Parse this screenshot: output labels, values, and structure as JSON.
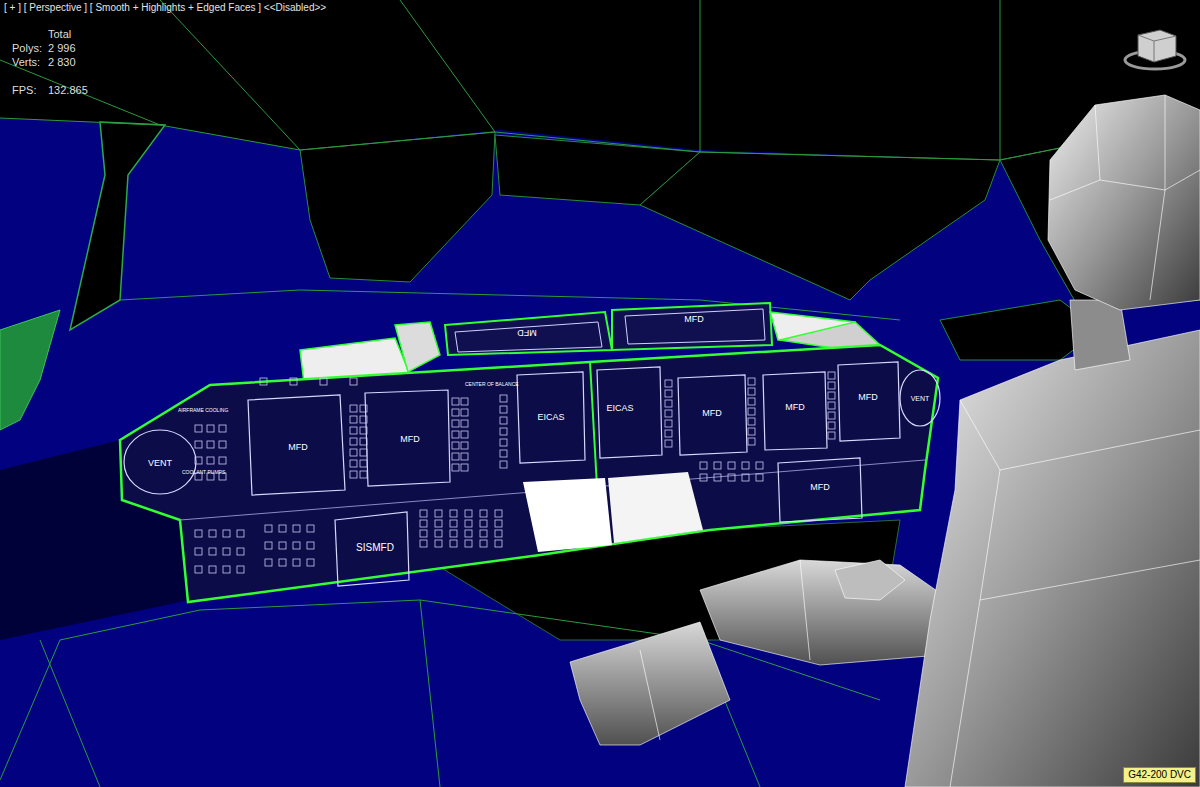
{
  "viewport": {
    "label": "[ + ] [ Perspective ] [ Smooth + Highlights + Edged Faces ] <<Disabled>>"
  },
  "stats": {
    "heading": "Total",
    "rows": [
      {
        "label": "Polys:",
        "value": "2 996"
      },
      {
        "label": "Verts:",
        "value": "2 830"
      }
    ],
    "fps_label": "FPS:",
    "fps_value": "132.865"
  },
  "scene": {
    "panel_labels": [
      "MFD",
      "MFD",
      "VENT",
      "MFD",
      "MFD",
      "EICAS",
      "EICAS",
      "MFD",
      "MFD",
      "MFD",
      "VENT",
      "MFD",
      "SISMFD"
    ],
    "small_labels": [
      "AIRFRAME COOLING",
      "CENTER OF BALANCE",
      "COOLANT PUMPS"
    ]
  },
  "corner_label": "G42-200 DVC"
}
